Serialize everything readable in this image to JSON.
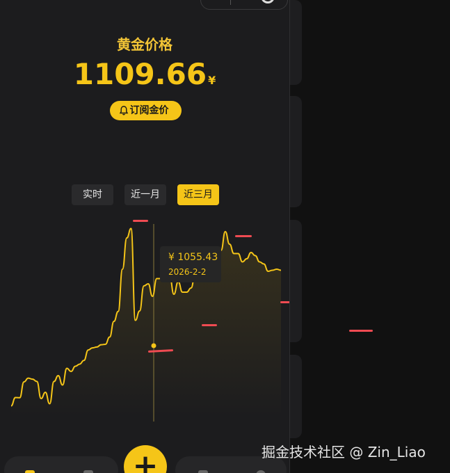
{
  "page": {
    "title": "黄金价格",
    "price": "1109.66",
    "currency": "¥",
    "subscribe_label": "订阅金价"
  },
  "tabs": [
    {
      "label": "实时",
      "active": false
    },
    {
      "label": "近一月",
      "active": false
    },
    {
      "label": "近三月",
      "active": true
    }
  ],
  "tooltip": {
    "value": "¥ 1055.43",
    "date": "2026-2-2"
  },
  "watermark": "掘金技术社区 @ Zin_Liao",
  "colors": {
    "accent": "#f5c518",
    "marker": "#ef4b52",
    "background": "#1c1c1e"
  },
  "chart_data": {
    "type": "line",
    "title": "",
    "xlabel": "",
    "ylabel": "",
    "highlighted_point": {
      "x": "2026-2-2",
      "y": 1055.43
    },
    "series": [
      {
        "values": [
          655,
          695,
          694,
          770,
          788,
          783,
          772,
          690,
          720,
          665,
          772,
          800,
          755,
          835,
          820,
          845,
          855,
          873,
          923,
          933,
          937,
          948,
          950,
          985,
          1060,
          1108,
          1310,
          1460,
          1505,
          1065,
          1110,
          1230,
          1240,
          1180,
          1265,
          1265,
          1268,
          1278,
          1190,
          1250,
          1200,
          1200,
          1220,
          1290,
          1345,
          1380,
          1390,
          1360,
          1370,
          1400,
          1490,
          1430,
          1385,
          1385,
          1345,
          1360,
          1390,
          1375,
          1345,
          1335,
          1300,
          1305,
          1310,
          1305
        ]
      }
    ]
  }
}
